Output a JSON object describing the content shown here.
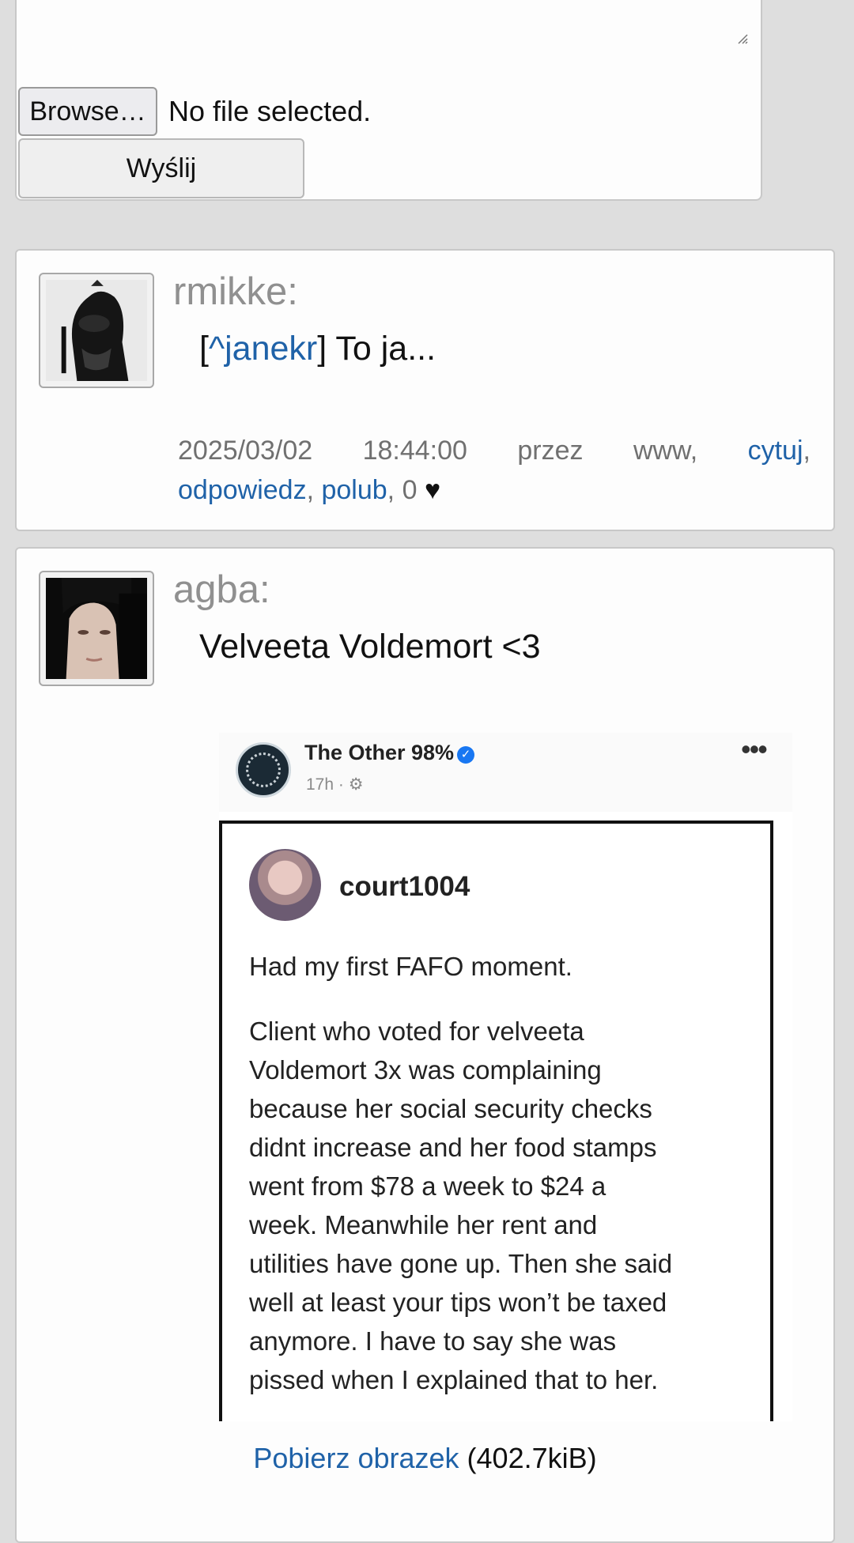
{
  "upload_form": {
    "browse_label": "Browse…",
    "file_status": "No file selected.",
    "send_label": "Wyślij"
  },
  "posts": [
    {
      "author": "rmikke:",
      "message": {
        "open_bracket": "[",
        "quote_link": "^janekr",
        "close_bracket": "] To ja..."
      },
      "meta": {
        "date": "2025/03/02",
        "time": "18:44:00",
        "via_word": "przez",
        "via_value": "www,",
        "quote_label": "cytuj",
        "reply_label": "odpowiedz",
        "like_label": "polub",
        "like_count": ", 0",
        "heart": "♥"
      }
    },
    {
      "author": "agba:",
      "message_text": "Velveeta Voldemort <3",
      "image": {
        "page_name": "The Other 98%",
        "verified_mark": "✓",
        "post_time": "17h · ⚙",
        "more": "•••",
        "inner_user": "court1004",
        "inner_first_line": "Had my first FAFO moment.",
        "inner_body": "Client who voted for velveeta\nVoldemort 3x was complaining\nbecause her social security checks\ndidnt increase and her food stamps\nwent from $78 a week to $24 a\nweek. Meanwhile her rent and\nutilities have gone up. Then she said\nwell at least your tips won’t be taxed\nanymore. I have to say she was\npissed when I explained that to her."
      },
      "download_link": "Pobierz obrazek",
      "download_size": "(402.7kiB)"
    }
  ]
}
